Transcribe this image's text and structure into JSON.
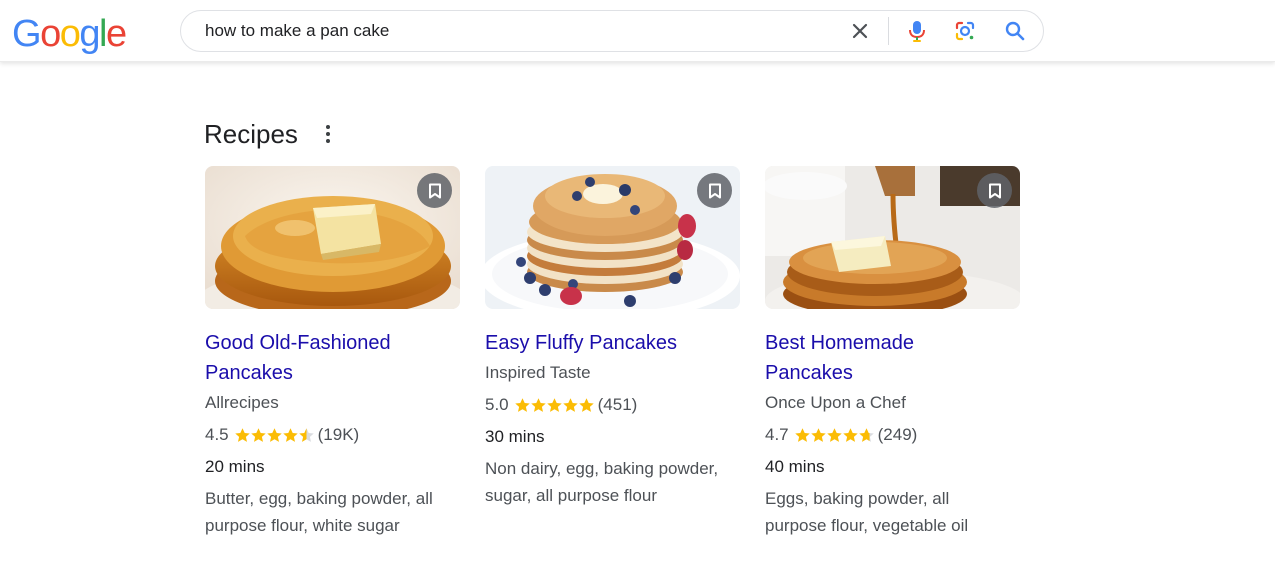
{
  "search": {
    "query": "how to make a pan cake"
  },
  "logo": {
    "letters": [
      "G",
      "o",
      "o",
      "g",
      "l",
      "e"
    ],
    "colors": [
      "#4285F4",
      "#EA4335",
      "#FBBC05",
      "#4285F4",
      "#34A853",
      "#EA4335"
    ]
  },
  "section": {
    "title": "Recipes"
  },
  "recipes": [
    {
      "title": "Good Old-Fashioned Pancakes",
      "source": "Allrecipes",
      "rating": "4.5",
      "rating_value": 4.5,
      "reviews": "(19K)",
      "time": "20 mins",
      "ingredients": "Butter, egg, baking powder, all purpose flour, white sugar"
    },
    {
      "title": "Easy Fluffy Pancakes",
      "source": "Inspired Taste",
      "rating": "5.0",
      "rating_value": 5.0,
      "reviews": "(451)",
      "time": "30 mins",
      "ingredients": "Non dairy, egg, baking powder, sugar, all purpose flour"
    },
    {
      "title": "Best Homemade Pancakes",
      "source": "Once Upon a Chef",
      "rating": "4.7",
      "rating_value": 4.7,
      "reviews": "(249)",
      "time": "40 mins",
      "ingredients": "Eggs, baking powder, all purpose flour, vegetable oil"
    }
  ],
  "colors": {
    "link": "#1a0dab",
    "star": "#fbbc04",
    "star_empty": "#dadce0"
  }
}
